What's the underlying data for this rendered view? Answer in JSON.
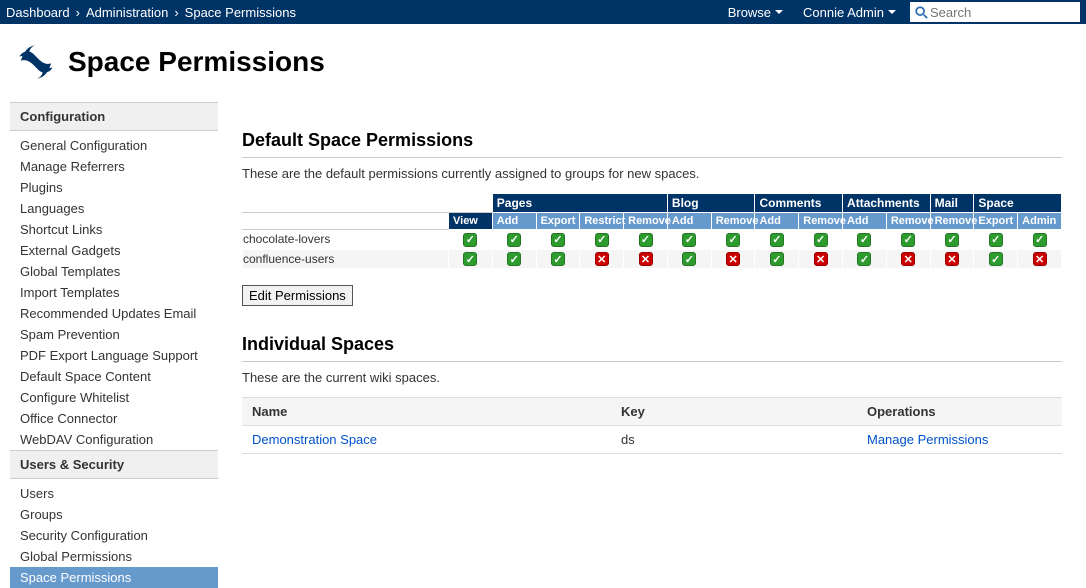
{
  "topbar": {
    "breadcrumb": [
      "Dashboard",
      "Administration",
      "Space Permissions"
    ],
    "browse_label": "Browse",
    "user_label": "Connie Admin",
    "search_placeholder": "Search"
  },
  "title": "Space Permissions",
  "sidebar": {
    "sections": [
      {
        "header": "Configuration",
        "items": [
          "General Configuration",
          "Manage Referrers",
          "Plugins",
          "Languages",
          "Shortcut Links",
          "External Gadgets",
          "Global Templates",
          "Import Templates",
          "Recommended Updates Email",
          "Spam Prevention",
          "PDF Export Language Support",
          "Default Space Content",
          "Configure Whitelist",
          "Office Connector",
          "WebDAV Configuration"
        ]
      },
      {
        "header": "Users & Security",
        "items": [
          "Users",
          "Groups",
          "Security Configuration",
          "Global Permissions",
          "Space Permissions"
        ]
      }
    ],
    "selected": "Space Permissions"
  },
  "defaults": {
    "heading": "Default Space Permissions",
    "intro": "These are the default permissions currently assigned to groups for new spaces.",
    "groups": [
      "Pages",
      "Blog",
      "Comments",
      "Attachments",
      "Mail",
      "Space"
    ],
    "view_label": "View",
    "columns": {
      "Pages": [
        "Add",
        "Export",
        "Restrict",
        "Remove"
      ],
      "Blog": [
        "Add",
        "Remove"
      ],
      "Comments": [
        "Add",
        "Remove"
      ],
      "Attachments": [
        "Add",
        "Remove"
      ],
      "Mail": [
        "Remove"
      ],
      "Space": [
        "Export",
        "Admin"
      ]
    },
    "rows": [
      {
        "name": "chocolate-lovers",
        "view": true,
        "perms": {
          "Pages": [
            true,
            true,
            true,
            true
          ],
          "Blog": [
            true,
            true
          ],
          "Comments": [
            true,
            true
          ],
          "Attachments": [
            true,
            true
          ],
          "Mail": [
            true
          ],
          "Space": [
            true,
            true
          ]
        }
      },
      {
        "name": "confluence-users",
        "view": true,
        "perms": {
          "Pages": [
            true,
            true,
            false,
            false
          ],
          "Blog": [
            true,
            false
          ],
          "Comments": [
            true,
            false
          ],
          "Attachments": [
            true,
            false
          ],
          "Mail": [
            false
          ],
          "Space": [
            true,
            false
          ]
        }
      }
    ],
    "edit_button": "Edit Permissions"
  },
  "individual": {
    "heading": "Individual Spaces",
    "intro": "These are the current wiki spaces.",
    "headers": [
      "Name",
      "Key",
      "Operations"
    ],
    "rows": [
      {
        "name": "Demonstration Space",
        "key": "ds",
        "op": "Manage Permissions"
      }
    ]
  }
}
